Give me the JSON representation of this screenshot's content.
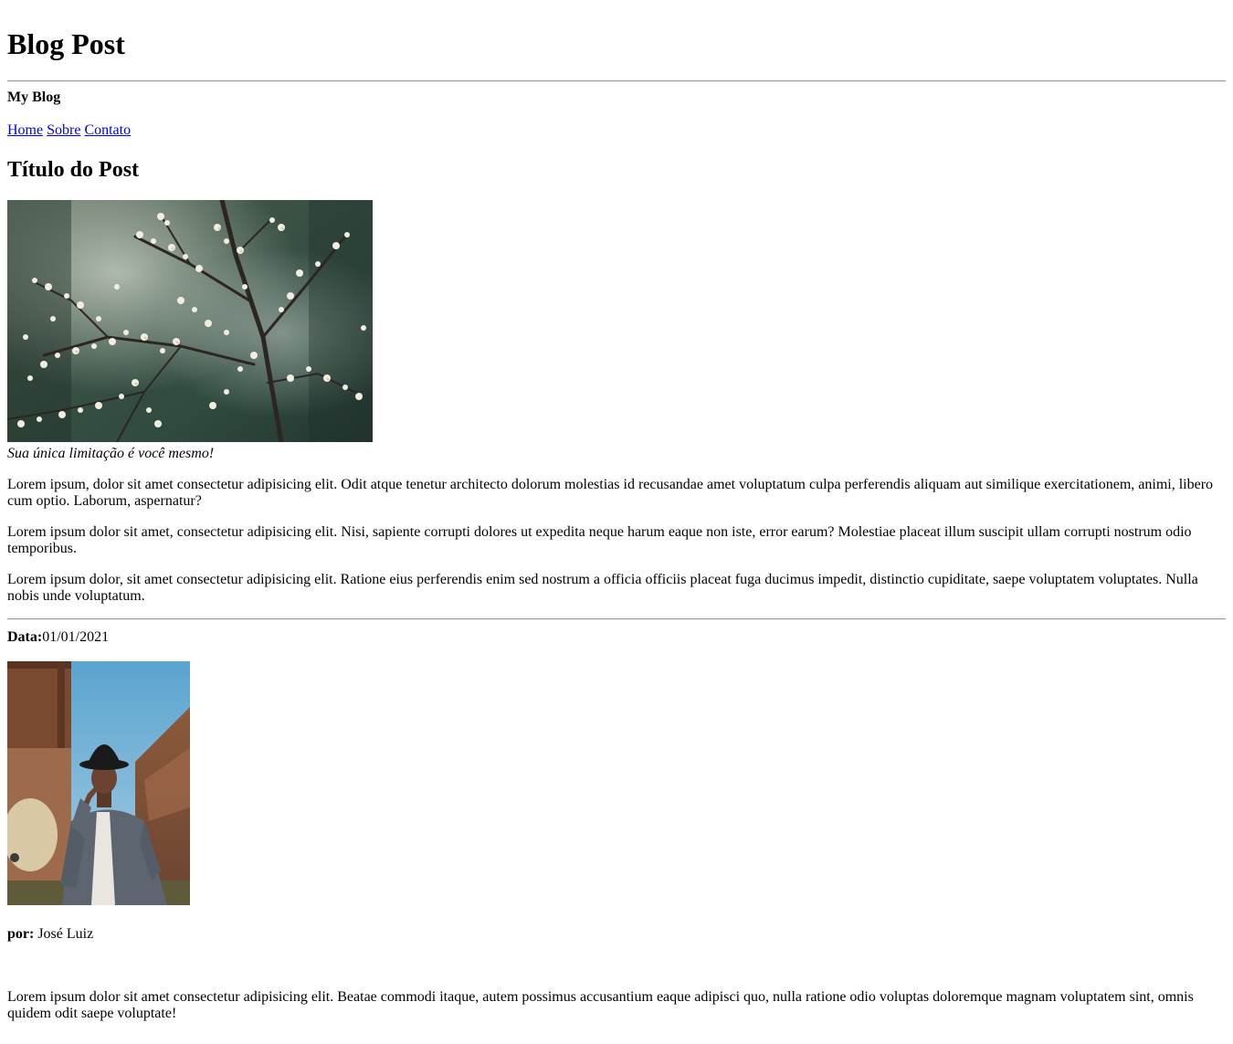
{
  "header": {
    "title": "Blog Post",
    "site_name": "My Blog"
  },
  "nav": {
    "items": [
      {
        "label": "Home"
      },
      {
        "label": "Sobre"
      },
      {
        "label": "Contato"
      }
    ]
  },
  "post": {
    "title": "Título do Post",
    "caption": "Sua única limitação é você mesmo!",
    "paragraphs": [
      "Lorem ipsum, dolor sit amet consectetur adipisicing elit. Odit atque tenetur architecto dolorum molestias id recusandae amet voluptatum culpa perferendis aliquam aut similique exercitationem, animi, libero cum optio. Laborum, aspernatur?",
      "Lorem ipsum dolor sit amet, consectetur adipisicing elit. Nisi, sapiente corrupti dolores ut expedita neque harum eaque non iste, error earum? Molestiae placeat illum suscipit ullam corrupti nostrum odio temporibus.",
      "Lorem ipsum dolor, sit amet consectetur adipisicing elit. Ratione eius perferendis enim sed nostrum a officia officiis placeat fuga ducimus impedit, distinctio cupiditate, saepe voluptatem voluptates. Nulla nobis unde voluptatum."
    ]
  },
  "meta": {
    "date_label": "Data:",
    "date_value": "01/01/2021"
  },
  "author": {
    "by_label": "por:",
    "name": "José Luiz",
    "bio": "Lorem ipsum dolor sit amet consectetur adipisicing elit. Beatae commodi itaque, autem possimus accusantium eaque adipisci quo, nulla ratione odio voluptas doloremque magnam voluptatem sint, omnis quidem odit saepe voluptate!"
  },
  "icons": {
    "hero_image": "blossom-branch-photo",
    "author_image": "man-in-hat-photo"
  }
}
